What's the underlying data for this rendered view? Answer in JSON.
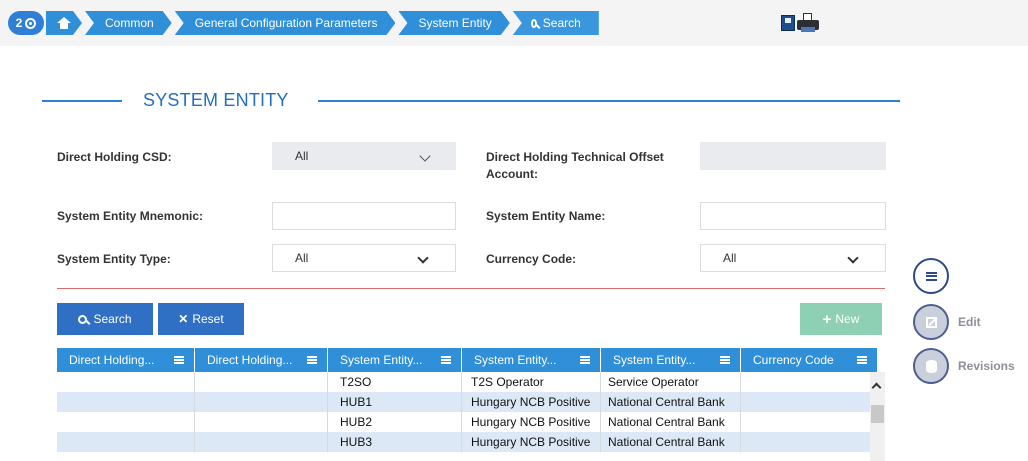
{
  "header": {
    "badge_count": "2",
    "breadcrumbs": [
      "Common",
      "General Configuration Parameters",
      "System Entity",
      "Search"
    ]
  },
  "page_title": "SYSTEM ENTITY",
  "form": {
    "direct_holding_csd": {
      "label": "Direct Holding CSD:",
      "value": "All"
    },
    "direct_holding_offset": {
      "label": "Direct Holding Technical Offset Account:",
      "value": ""
    },
    "mnemonic": {
      "label": "System Entity Mnemonic:",
      "value": ""
    },
    "name": {
      "label": "System Entity Name:",
      "value": ""
    },
    "type": {
      "label": "System Entity Type:",
      "value": "All"
    },
    "currency": {
      "label": "Currency Code:",
      "value": "All"
    }
  },
  "buttons": {
    "search": "Search",
    "reset": "Reset",
    "new": "New"
  },
  "grid": {
    "columns": [
      "Direct Holding...",
      "Direct Holding...",
      "System Entity...",
      "System Entity...",
      "System Entity...",
      "Currency Code"
    ],
    "rows": [
      [
        "",
        "",
        "T2SO",
        "T2S Operator",
        "Service Operator",
        ""
      ],
      [
        "",
        "",
        "HUB1",
        "Hungary NCB Positive",
        "National Central Bank",
        ""
      ],
      [
        "",
        "",
        "HUB2",
        "Hungary NCB Positive",
        "National Central Bank",
        ""
      ],
      [
        "",
        "",
        "HUB3",
        "Hungary NCB Positive",
        "National Central Bank",
        ""
      ]
    ]
  },
  "side_actions": {
    "edit": "Edit",
    "revisions": "Revisions"
  },
  "colors": {
    "accent": "#2f8fd9",
    "primary_button": "#2f6fc4",
    "new_button": "#8ed0b4",
    "divider": "#d96b6b"
  }
}
